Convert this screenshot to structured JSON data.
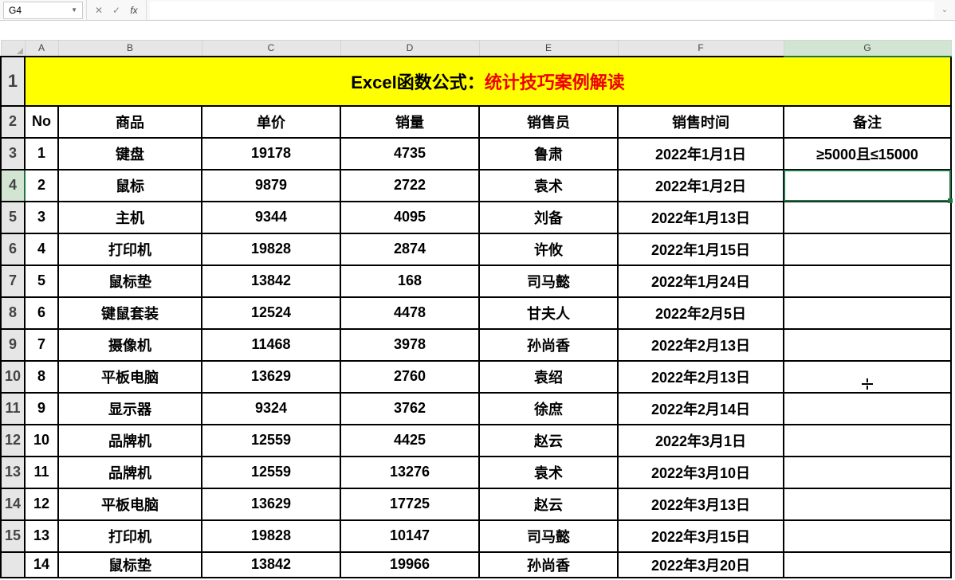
{
  "formula_bar": {
    "name_box": "G4",
    "cancel": "✕",
    "confirm": "✓",
    "fx": "fx",
    "formula": ""
  },
  "columns": [
    "A",
    "B",
    "C",
    "D",
    "E",
    "F",
    "G"
  ],
  "title": {
    "part1": "Excel函数公式：",
    "part2": "统计技巧案例解读"
  },
  "headers": {
    "no": "No",
    "product": "商品",
    "price": "单价",
    "sales": "销量",
    "salesperson": "销售员",
    "sale_time": "销售时间",
    "remark": "备注"
  },
  "rows": [
    {
      "rh": "3",
      "no": "1",
      "product": "键盘",
      "price": "19178",
      "sales": "4735",
      "salesperson": "鲁肃",
      "sale_time": "2022年1月1日",
      "remark": "≥5000且≤15000"
    },
    {
      "rh": "4",
      "no": "2",
      "product": "鼠标",
      "price": "9879",
      "sales": "2722",
      "salesperson": "袁术",
      "sale_time": "2022年1月2日",
      "remark": ""
    },
    {
      "rh": "5",
      "no": "3",
      "product": "主机",
      "price": "9344",
      "sales": "4095",
      "salesperson": "刘备",
      "sale_time": "2022年1月13日",
      "remark": ""
    },
    {
      "rh": "6",
      "no": "4",
      "product": "打印机",
      "price": "19828",
      "sales": "2874",
      "salesperson": "许攸",
      "sale_time": "2022年1月15日",
      "remark": ""
    },
    {
      "rh": "7",
      "no": "5",
      "product": "鼠标垫",
      "price": "13842",
      "sales": "168",
      "salesperson": "司马懿",
      "sale_time": "2022年1月24日",
      "remark": ""
    },
    {
      "rh": "8",
      "no": "6",
      "product": "键鼠套装",
      "price": "12524",
      "sales": "4478",
      "salesperson": "甘夫人",
      "sale_time": "2022年2月5日",
      "remark": ""
    },
    {
      "rh": "9",
      "no": "7",
      "product": "摄像机",
      "price": "11468",
      "sales": "3978",
      "salesperson": "孙尚香",
      "sale_time": "2022年2月13日",
      "remark": ""
    },
    {
      "rh": "10",
      "no": "8",
      "product": "平板电脑",
      "price": "13629",
      "sales": "2760",
      "salesperson": "袁绍",
      "sale_time": "2022年2月13日",
      "remark": ""
    },
    {
      "rh": "11",
      "no": "9",
      "product": "显示器",
      "price": "9324",
      "sales": "3762",
      "salesperson": "徐庶",
      "sale_time": "2022年2月14日",
      "remark": ""
    },
    {
      "rh": "12",
      "no": "10",
      "product": "品牌机",
      "price": "12559",
      "sales": "4425",
      "salesperson": "赵云",
      "sale_time": "2022年3月1日",
      "remark": ""
    },
    {
      "rh": "13",
      "no": "11",
      "product": "品牌机",
      "price": "12559",
      "sales": "13276",
      "salesperson": "袁术",
      "sale_time": "2022年3月10日",
      "remark": ""
    },
    {
      "rh": "14",
      "no": "12",
      "product": "平板电脑",
      "price": "13629",
      "sales": "17725",
      "salesperson": "赵云",
      "sale_time": "2022年3月13日",
      "remark": ""
    },
    {
      "rh": "15",
      "no": "13",
      "product": "打印机",
      "price": "19828",
      "sales": "10147",
      "salesperson": "司马懿",
      "sale_time": "2022年3月15日",
      "remark": ""
    }
  ],
  "clip_row": {
    "rh": "",
    "no": "14",
    "product": "鼠标垫",
    "price": "13842",
    "sales": "19966",
    "salesperson": "孙尚香",
    "sale_time": "2022年3月20日",
    "remark": ""
  },
  "row_hdr_title": "1",
  "row_hdr_headers": "2"
}
